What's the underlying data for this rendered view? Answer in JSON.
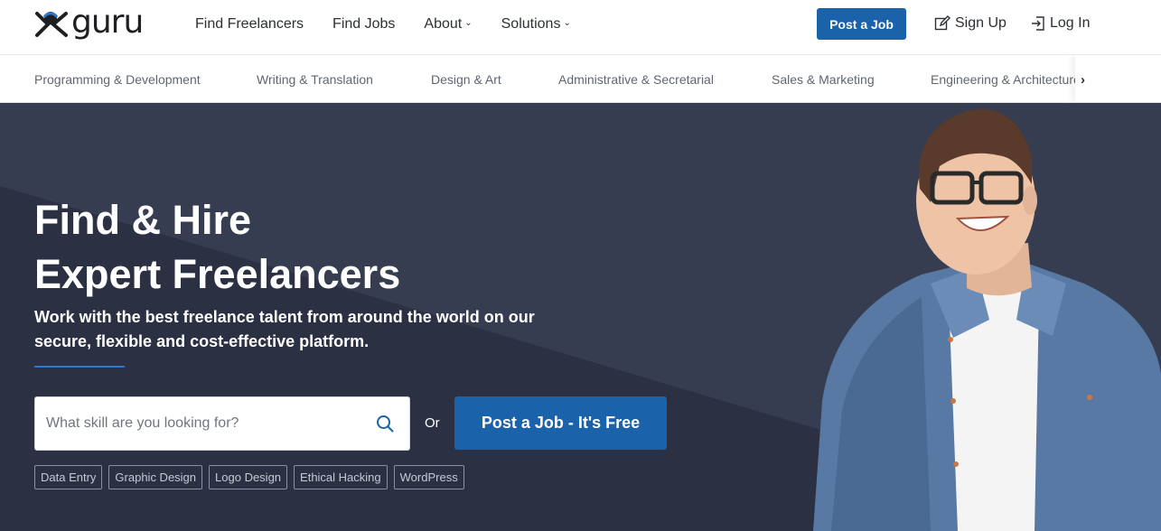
{
  "brand": {
    "name": "guru"
  },
  "nav": {
    "links": [
      {
        "label": "Find Freelancers",
        "has_caret": false
      },
      {
        "label": "Find Jobs",
        "has_caret": false
      },
      {
        "label": "About",
        "has_caret": true
      },
      {
        "label": "Solutions",
        "has_caret": true
      }
    ],
    "post_job": "Post a Job",
    "sign_up": "Sign Up",
    "log_in": "Log In"
  },
  "categories": [
    "Programming & Development",
    "Writing & Translation",
    "Design & Art",
    "Administrative & Secretarial",
    "Sales & Marketing",
    "Engineering & Architecture"
  ],
  "hero": {
    "headline_line1": "Find & Hire",
    "headline_line2": "Expert Freelancers",
    "subhead": "Work with the best freelance talent from around the world on our secure, flexible and cost-effective platform.",
    "search_placeholder": "What skill are you looking for?",
    "or_label": "Or",
    "cta": "Post a Job - It's Free",
    "tags": [
      "Data Entry",
      "Graphic Design",
      "Logo Design",
      "Ethical Hacking",
      "WordPress"
    ]
  },
  "icons": {
    "search": "search-icon",
    "sign_up": "edit-icon",
    "log_in": "login-icon",
    "scroll_right": "chevron-right-icon"
  },
  "colors": {
    "primary": "#1a62aa",
    "hero_bg": "#363d51",
    "accent_line": "#2d79c7"
  }
}
